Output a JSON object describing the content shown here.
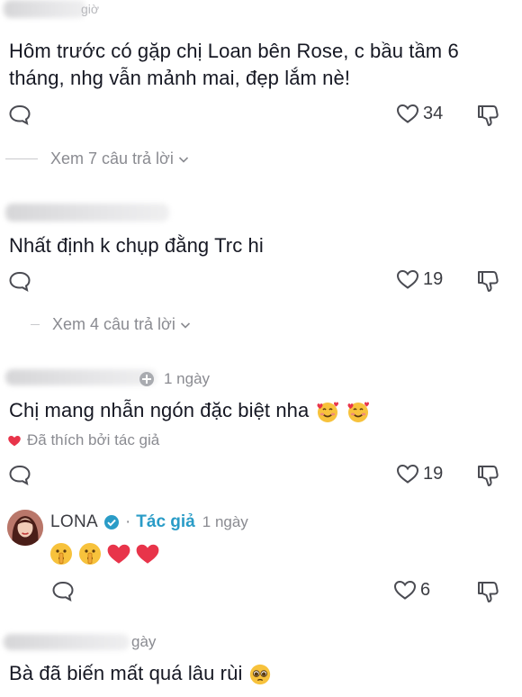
{
  "comments": [
    {
      "time": "giờ",
      "text": "Hôm trước có gặp chị Loan bên Rose, c bầu tầm 6 tháng, nhg vẫn mảnh mai, đẹp lắm nè!",
      "likes": "34",
      "view_replies": "Xem 7 câu trả lời"
    },
    {
      "text": "Nhất định k chụp đằng Trc hi",
      "likes": "19",
      "view_replies": "Xem 4 câu trả lời"
    },
    {
      "time": "1 ngày",
      "text": "Chị mang nhẫn ngón đặc biệt nha",
      "liked_by_author": "Đã thích bởi tác giả",
      "likes": "19"
    },
    {
      "author": "LONA",
      "author_tag": "Tác giả",
      "separator": "·",
      "time": "1 ngày",
      "likes": "6"
    },
    {
      "time": "gày",
      "text": "Bà đã biến mất quá lâu rùi"
    }
  ],
  "colors": {
    "text": "#161823",
    "muted": "#8a8b91",
    "author_tag": "#2a9cc7",
    "verified": "#2a9cc7",
    "heart_red": "#e8344a"
  }
}
